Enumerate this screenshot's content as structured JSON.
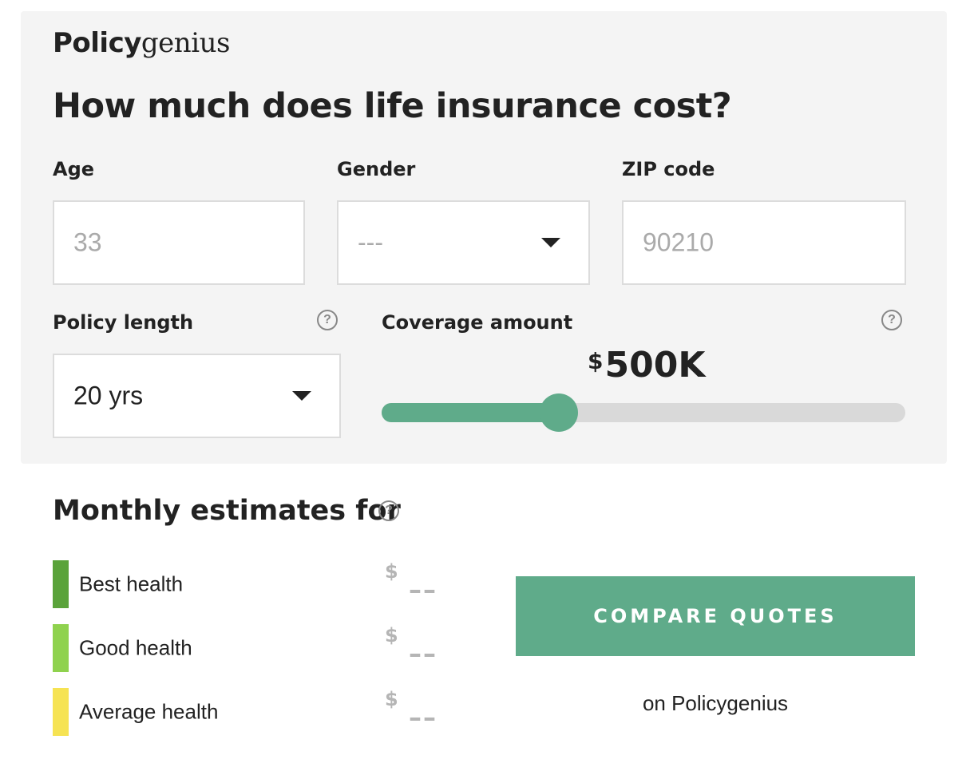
{
  "brand": {
    "logo_bold": "Policy",
    "logo_light": "genius"
  },
  "heading": "How much does life insurance cost?",
  "form": {
    "age": {
      "label": "Age",
      "placeholder": "33"
    },
    "gender": {
      "label": "Gender",
      "value": "---"
    },
    "zip": {
      "label": "ZIP code",
      "placeholder": "90210"
    },
    "policy_length": {
      "label": "Policy length",
      "value": "20 yrs",
      "help_icon": "question-circle-icon"
    },
    "coverage": {
      "label": "Coverage amount",
      "currency": "$",
      "amount": "500K",
      "slider_fraction": 0.338,
      "help_icon": "question-circle-icon"
    }
  },
  "estimates": {
    "title": "Monthly estimates for",
    "help_icon": "question-circle-icon",
    "tiers": [
      {
        "label": "Best health",
        "color": "#5aa33a",
        "currency": "$",
        "price": "––"
      },
      {
        "label": "Good health",
        "color": "#8fd24e",
        "currency": "$",
        "price": "––"
      },
      {
        "label": "Average health",
        "color": "#f6e353",
        "currency": "$",
        "price": "––"
      }
    ]
  },
  "cta": {
    "label": "COMPARE QUOTES",
    "note": "on Policygenius"
  },
  "colors": {
    "accent": "#5fab8a",
    "panel_bg": "#f4f4f4",
    "track": "#d9d9d9"
  }
}
